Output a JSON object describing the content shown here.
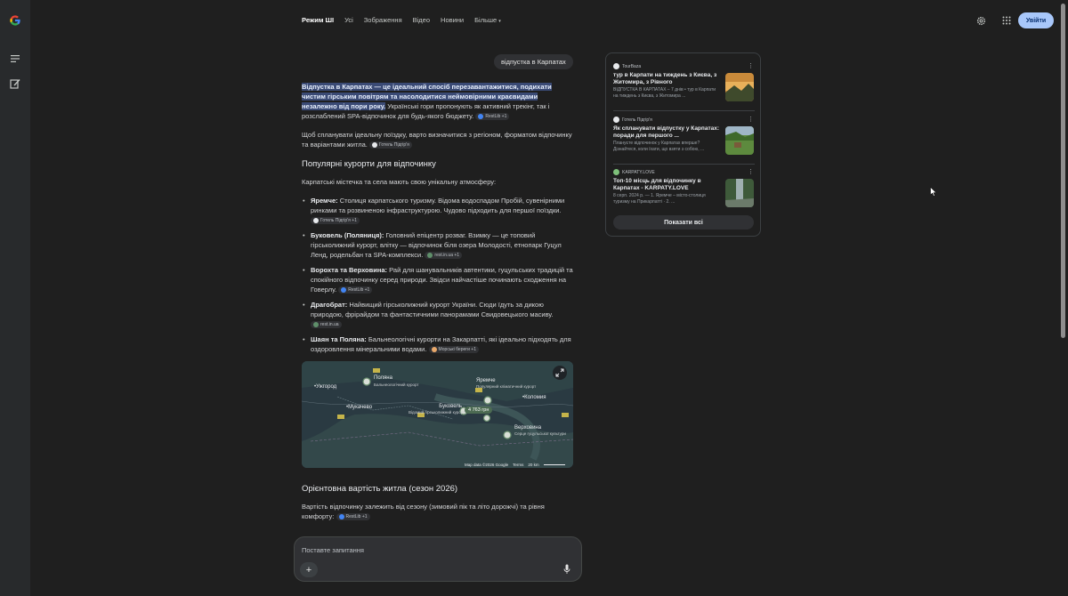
{
  "nav": {
    "tabs": [
      "Режим ШІ",
      "Усі",
      "Зображення",
      "Відео",
      "Новини",
      "Більше"
    ],
    "signin_label": "Увійти"
  },
  "chat": {
    "user_query": "відпустка в Карпатах",
    "intro_highlight": "Відпустка в Карпатах — це ідеальний спосіб перезавантажитися, подихати чистим гірським повітрям та насолодитися неймовірними краєвидами незалежно від пори року.",
    "intro_rest": " Українські гори пропонують як активний трекінг, так і розслаблений SPA-відпочинок для будь-якого бюджету.",
    "intro_chip": "RestLib +1",
    "para2": "Щоб спланувати ідеальну поїздку, варто визначитися з регіоном, форматом відпочинку та варіантами житла.",
    "para2_chip": "Готель Підгір'я",
    "resorts_heading": "Популярні курорти для відпочинку",
    "resorts_intro": "Карпатські містечка та села мають свою унікальну атмосферу:",
    "resorts": [
      {
        "name": "Яремче:",
        "text": " Столиця карпатського туризму. Відома водоспадом Пробій, сувенірними ринками та розвиненою інфраструктурою. Чудово підходить для першої поїздки.",
        "chip": "Готель Підгір'я +1"
      },
      {
        "name": "Буковель (Поляниця):",
        "text": " Головний епіцентр розваг. Взимку — це топовий гірськолижний курорт, влітку — відпочинок біля озера Молодості, етнопарк Гуцул Ленд, родельбан та SPA-комплекси.",
        "chip": "rest.in.ua +1"
      },
      {
        "name": "Ворохта та Верховина:",
        "text": " Рай для шанувальників автентики, гуцульських традицій та спокійного відпочинку серед природи. Звідси найчастіше починають сходження на Говерлу.",
        "chip": "RestLib +1"
      },
      {
        "name": "Драгобрат:",
        "text": " Найвищий гірськолижний курорт України. Сюди їдуть за дикою природою, фрірайдом та фантастичними панорамами Свидовецького масиву.",
        "chip": "rest.in.ua"
      },
      {
        "name": "Шаян та Поляна:",
        "text": " Бальнеологічні курорти на Закарпатті, які ідеально підходять для оздоровлення мінеральними водами.",
        "chip": "Морські береги +1"
      }
    ],
    "cost_heading": "Орієнтовна вартість житла (сезон 2026)",
    "cost_text": "Вартість відпочинку залежить від сезону (зимовий пік та літо дорожчі) та рівня комфорту:",
    "cost_chip": "RestLib +1"
  },
  "map": {
    "places": [
      {
        "name": "Ужгород",
        "sub": ""
      },
      {
        "name": "Поляна",
        "sub": "Бальнеологічний курорт"
      },
      {
        "name": "Мукачево",
        "sub": ""
      },
      {
        "name": "Яремче",
        "sub": "Популярний кліматичний курорт"
      },
      {
        "name": "Коломия",
        "sub": ""
      },
      {
        "name": "Буковель",
        "sub": "Відомий гірськолижний курорт"
      },
      {
        "name": "Верховина",
        "sub": "Серце гуцульської культури"
      }
    ],
    "price_tag": "4 763 грн",
    "attribution": "Map data ©2026 Google",
    "terms": "Terms",
    "scale": "20 km"
  },
  "ask": {
    "placeholder": "Поставте запитання"
  },
  "sources": {
    "items": [
      {
        "site": "TourBaza",
        "title": "тур в Карпати на тиждень з Києва, з Житомира, з Рівного",
        "snippet": "ВІДПУСТКА В КАРПАТАХ – 7 днів • тур в Карпати на тиждень з Києва, з Житомира ..."
      },
      {
        "site": "Готель Підгір'я",
        "title": "Як спланувати відпустку у Карпатах: поради для першого ...",
        "snippet": "Плануєте відпочинок у Карпатах вперше? Дізнайтеся, коли їхати, що взяти з собою, ..."
      },
      {
        "site": "KARPATY.LOVE",
        "title": "Топ-10 місць для відпочинку в Карпатах - KARPATY.LOVE",
        "snippet": "8 серп. 2024 р. — 1. Яремче – місто-столиця туризму на Прикарпатті · 2. ..."
      }
    ],
    "show_all": "Показати всі"
  }
}
